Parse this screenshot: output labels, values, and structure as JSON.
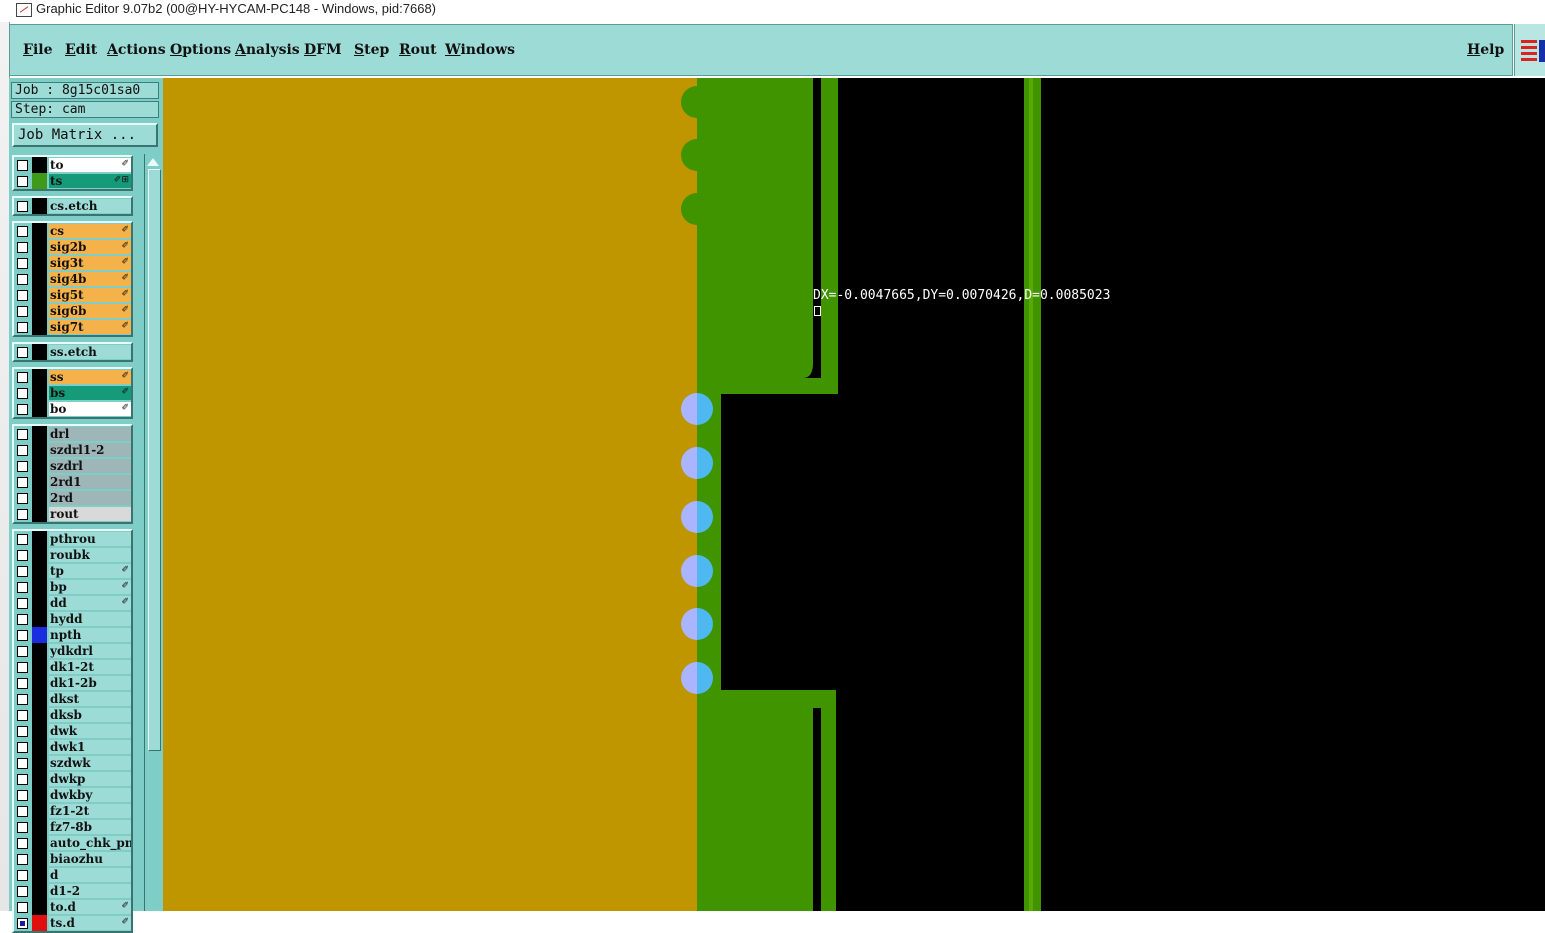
{
  "window": {
    "title": "Graphic Editor 9.07b2 (00@HY-HYCAM-PC148 - Windows, pid:7668)"
  },
  "menu": {
    "items": [
      "File",
      "Edit",
      "Actions",
      "Options",
      "Analysis",
      "DFM",
      "Step",
      "Rout",
      "Windows"
    ],
    "help": "Help"
  },
  "job": {
    "job_label": "Job : 8g15c01sa0",
    "step_label": "Step: cam",
    "matrix_button": "Job Matrix ..."
  },
  "layers": [
    {
      "name": "to",
      "bg": "#ffffff",
      "swatch": "#000000",
      "mark": "✐",
      "group": 0
    },
    {
      "name": "ts",
      "bg": "#159a7a",
      "swatch": "#3f9a1a",
      "mark": "✐⊞",
      "group": 0
    },
    {
      "name": "cs.etch",
      "bg": "#9cdbd6",
      "swatch": "#000000",
      "mark": "",
      "group": 1
    },
    {
      "name": "cs",
      "bg": "#f6b24a",
      "swatch": "#000000",
      "mark": "✐",
      "group": 2
    },
    {
      "name": "sig2b",
      "bg": "#f6b24a",
      "swatch": "#000000",
      "mark": "✐",
      "group": 2
    },
    {
      "name": "sig3t",
      "bg": "#f6b24a",
      "swatch": "#000000",
      "mark": "✐",
      "group": 2
    },
    {
      "name": "sig4b",
      "bg": "#f6b24a",
      "swatch": "#000000",
      "mark": "✐",
      "group": 2
    },
    {
      "name": "sig5t",
      "bg": "#f6b24a",
      "swatch": "#000000",
      "mark": "✐",
      "group": 2
    },
    {
      "name": "sig6b",
      "bg": "#f6b24a",
      "swatch": "#000000",
      "mark": "✐",
      "group": 2
    },
    {
      "name": "sig7t",
      "bg": "#f6b24a",
      "swatch": "#000000",
      "mark": "✐",
      "group": 2
    },
    {
      "name": "ss.etch",
      "bg": "#9cdbd6",
      "swatch": "#000000",
      "mark": "",
      "group": 3
    },
    {
      "name": "ss",
      "bg": "#f6b24a",
      "swatch": "#000000",
      "mark": "✐",
      "group": 4
    },
    {
      "name": "bs",
      "bg": "#159a7a",
      "swatch": "#000000",
      "mark": "✐",
      "group": 4
    },
    {
      "name": "bo",
      "bg": "#ffffff",
      "swatch": "#000000",
      "mark": "✐",
      "group": 4
    },
    {
      "name": "drl",
      "bg": "#9fb6b8",
      "swatch": "#000000",
      "mark": "",
      "group": 5
    },
    {
      "name": "szdrl1-2",
      "bg": "#9fb6b8",
      "swatch": "#000000",
      "mark": "",
      "group": 5
    },
    {
      "name": "szdrl",
      "bg": "#9fb6b8",
      "swatch": "#000000",
      "mark": "",
      "group": 5
    },
    {
      "name": "2rd1",
      "bg": "#9fb6b8",
      "swatch": "#000000",
      "mark": "",
      "group": 5
    },
    {
      "name": "2rd",
      "bg": "#9fb6b8",
      "swatch": "#000000",
      "mark": "",
      "group": 5
    },
    {
      "name": "rout",
      "bg": "#d9d9d9",
      "swatch": "#000000",
      "mark": "",
      "group": 5
    },
    {
      "name": "pthrou",
      "bg": "#9cdbd6",
      "swatch": "#000000",
      "mark": "",
      "group": 6
    },
    {
      "name": "roubk",
      "bg": "#9cdbd6",
      "swatch": "#000000",
      "mark": "",
      "group": 6
    },
    {
      "name": "tp",
      "bg": "#9cdbd6",
      "swatch": "#000000",
      "mark": "✐",
      "group": 6
    },
    {
      "name": "bp",
      "bg": "#9cdbd6",
      "swatch": "#000000",
      "mark": "✐",
      "group": 6
    },
    {
      "name": "dd",
      "bg": "#9cdbd6",
      "swatch": "#000000",
      "mark": "✐",
      "group": 6
    },
    {
      "name": "hydd",
      "bg": "#9cdbd6",
      "swatch": "#000000",
      "mark": "",
      "group": 6
    },
    {
      "name": "npth",
      "bg": "#9cdbd6",
      "swatch": "#1a2ee0",
      "mark": "",
      "group": 6
    },
    {
      "name": "ydkdrl",
      "bg": "#9cdbd6",
      "swatch": "#000000",
      "mark": "",
      "group": 6
    },
    {
      "name": "dk1-2t",
      "bg": "#9cdbd6",
      "swatch": "#000000",
      "mark": "",
      "group": 6
    },
    {
      "name": "dk1-2b",
      "bg": "#9cdbd6",
      "swatch": "#000000",
      "mark": "",
      "group": 6
    },
    {
      "name": "dkst",
      "bg": "#9cdbd6",
      "swatch": "#000000",
      "mark": "",
      "group": 6
    },
    {
      "name": "dksb",
      "bg": "#9cdbd6",
      "swatch": "#000000",
      "mark": "",
      "group": 6
    },
    {
      "name": "dwk",
      "bg": "#9cdbd6",
      "swatch": "#000000",
      "mark": "",
      "group": 6
    },
    {
      "name": "dwk1",
      "bg": "#9cdbd6",
      "swatch": "#000000",
      "mark": "",
      "group": 6
    },
    {
      "name": "szdwk",
      "bg": "#9cdbd6",
      "swatch": "#000000",
      "mark": "",
      "group": 6
    },
    {
      "name": "dwkp",
      "bg": "#9cdbd6",
      "swatch": "#000000",
      "mark": "",
      "group": 6
    },
    {
      "name": "dwkby",
      "bg": "#9cdbd6",
      "swatch": "#000000",
      "mark": "",
      "group": 6
    },
    {
      "name": "fz1-2t",
      "bg": "#9cdbd6",
      "swatch": "#000000",
      "mark": "",
      "group": 6
    },
    {
      "name": "fz7-8b",
      "bg": "#9cdbd6",
      "swatch": "#000000",
      "mark": "",
      "group": 6
    },
    {
      "name": "auto_chk_pnl",
      "bg": "#9cdbd6",
      "swatch": "#000000",
      "mark": "",
      "group": 6
    },
    {
      "name": "biaozhu",
      "bg": "#9cdbd6",
      "swatch": "#000000",
      "mark": "",
      "group": 6
    },
    {
      "name": "d",
      "bg": "#9cdbd6",
      "swatch": "#000000",
      "mark": "",
      "group": 6
    },
    {
      "name": "d1-2",
      "bg": "#9cdbd6",
      "swatch": "#000000",
      "mark": "",
      "group": 6
    },
    {
      "name": "to.d",
      "bg": "#9cdbd6",
      "swatch": "#000000",
      "mark": "✐",
      "group": 6
    },
    {
      "name": "ts.d",
      "bg": "#9cdbd6",
      "swatch": "#e01010",
      "mark": "✐",
      "group": 6,
      "checked": true
    }
  ],
  "canvas": {
    "measurement": "DX=-0.0047665,DY=0.0070426,D=0.0085023",
    "colors": {
      "background": "#000000",
      "copper": "#bf9500",
      "soldermask": "#3f9400",
      "hole_left": "#aab4ff",
      "hole_right": "#4fb8f0"
    }
  }
}
